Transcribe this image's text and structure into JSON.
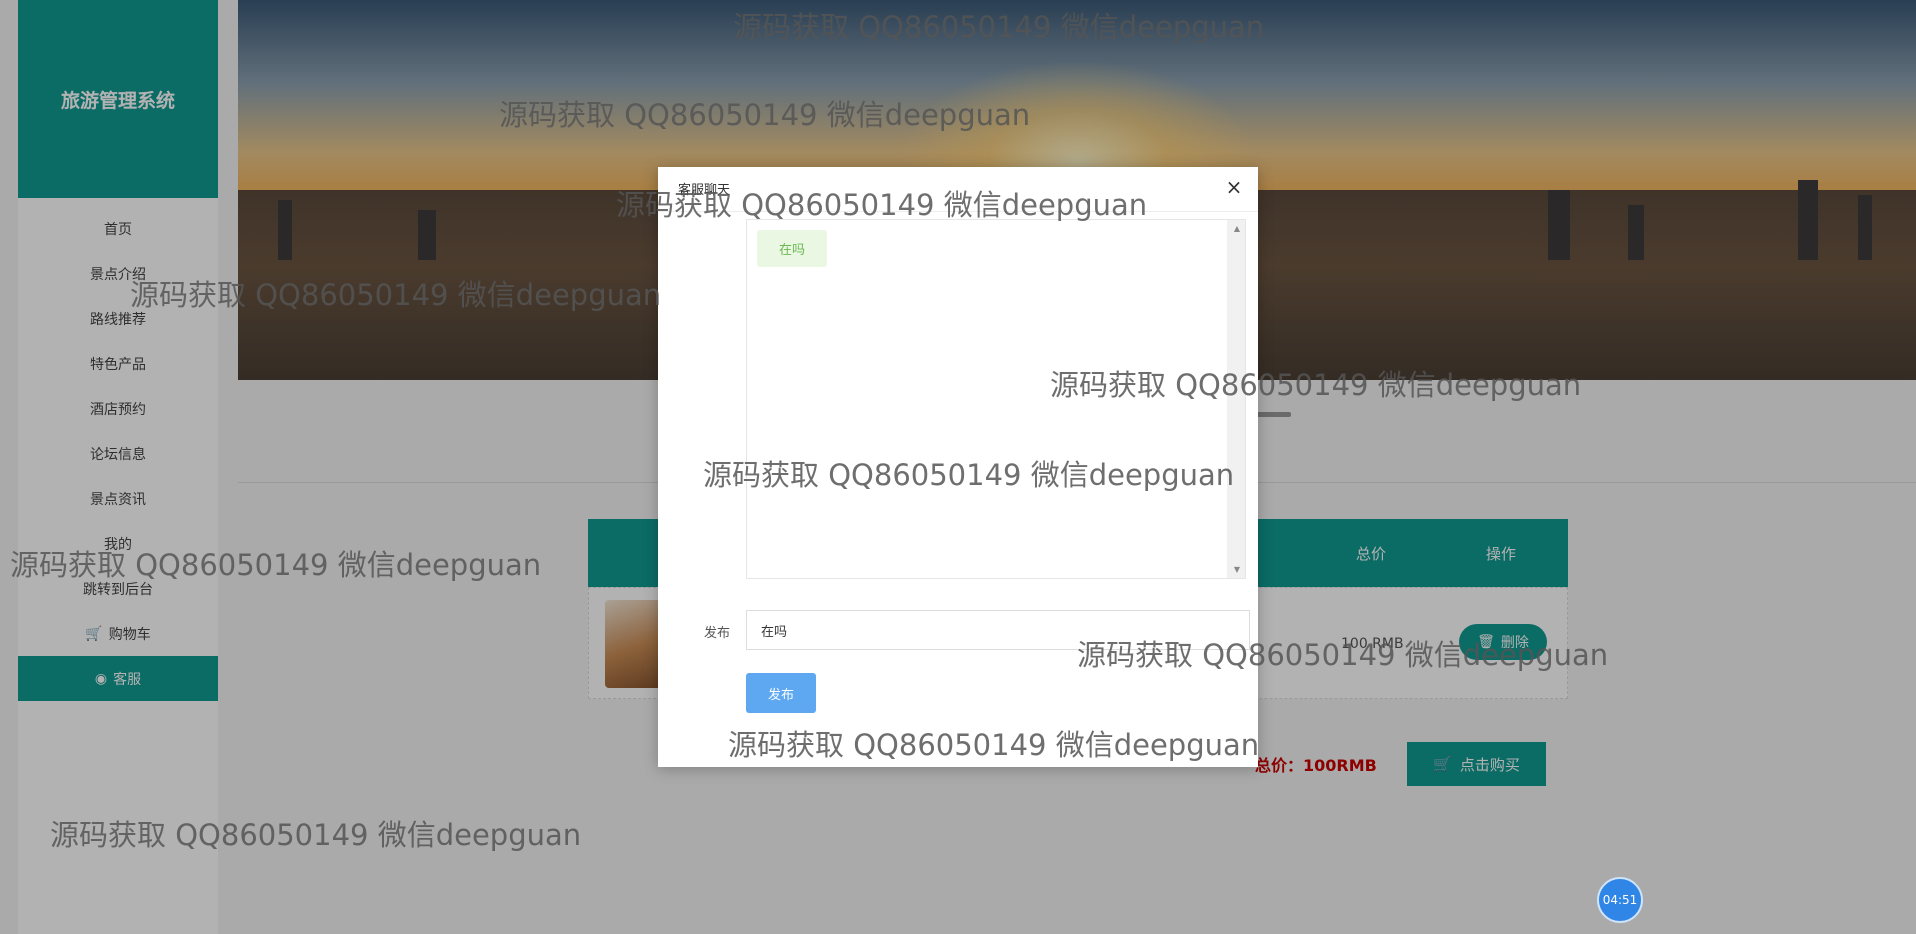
{
  "sidebar": {
    "logo": "旅游管理系统",
    "items": [
      {
        "label": "首页"
      },
      {
        "label": "景点介绍"
      },
      {
        "label": "路线推荐"
      },
      {
        "label": "特色产品"
      },
      {
        "label": "酒店预约"
      },
      {
        "label": "论坛信息"
      },
      {
        "label": "景点资讯"
      },
      {
        "label": "我的"
      },
      {
        "label": "跳转到后台"
      }
    ],
    "cart_label": "购物车",
    "service_label": "客服"
  },
  "cart": {
    "header": {
      "total": "总价",
      "operation": "操作"
    },
    "row": {
      "price": "100 RMB",
      "delete_label": "删除"
    },
    "total_label": "总价：100RMB",
    "buy_label": "点击购买"
  },
  "dialog": {
    "title": "客服聊天",
    "close_icon": "close-icon",
    "message": "在吗",
    "field_label": "发布",
    "input_value": "在吗",
    "send_label": "发布"
  },
  "watermark": "源码获取 QQ86050149 微信deepguan",
  "timer": "04:51",
  "colors": {
    "primary": "#109a91",
    "send": "#5da8f0",
    "total": "#cc0000"
  }
}
